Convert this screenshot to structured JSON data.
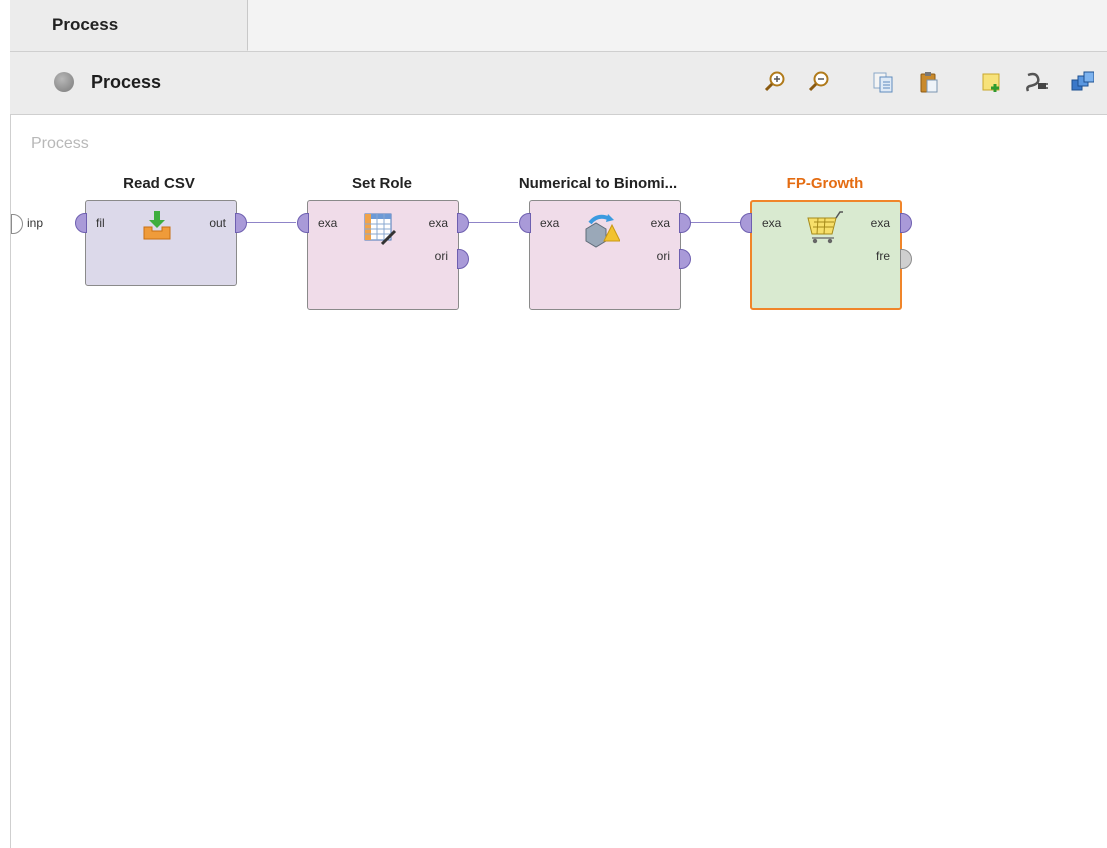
{
  "tabs": [
    {
      "label": "Process",
      "active": true
    }
  ],
  "toolbar": {
    "title": "Process",
    "buttons": [
      {
        "name": "zoom-in-icon"
      },
      {
        "name": "zoom-out-icon"
      },
      {
        "name": "copy-icon"
      },
      {
        "name": "paste-icon"
      },
      {
        "name": "new-note-icon"
      },
      {
        "name": "auto-wire-icon"
      },
      {
        "name": "arrange-icon"
      }
    ]
  },
  "canvas": {
    "label": "Process",
    "input_port": "inp",
    "operators": [
      {
        "title": "Read CSV",
        "icon": "download-icon",
        "in": [
          "fil"
        ],
        "out": [
          "out"
        ]
      },
      {
        "title": "Set Role",
        "icon": "table-edit-icon",
        "in": [
          "exa"
        ],
        "out": [
          "exa",
          "ori"
        ]
      },
      {
        "title": "Numerical to Binomi...",
        "icon": "convert-icon",
        "in": [
          "exa"
        ],
        "out": [
          "exa",
          "ori"
        ]
      },
      {
        "title": "FP-Growth",
        "icon": "shopping-cart-icon",
        "in": [
          "exa"
        ],
        "out": [
          "exa",
          "fre"
        ],
        "selected": true
      }
    ]
  },
  "colors": {
    "accent_selected": "#e46c12",
    "port_purple": "#a99ad8",
    "wire": "#8f84c8"
  }
}
